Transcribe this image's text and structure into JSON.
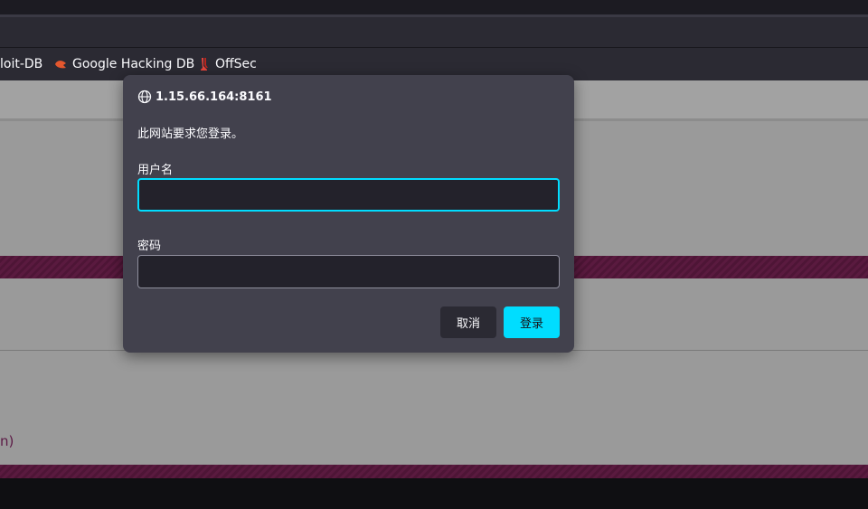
{
  "bookmarks": {
    "items": [
      {
        "label": "loit-DB",
        "icon": "exploit-db-icon"
      },
      {
        "label": "Google Hacking DB",
        "icon": "google-hacking-db-icon"
      },
      {
        "label": "OffSec",
        "icon": "offsec-icon"
      }
    ]
  },
  "page": {
    "link_fragment": "n)"
  },
  "dialog": {
    "origin": "1.15.66.164:8161",
    "message": "此网站要求您登录。",
    "username_label": "用户名",
    "username_value": "",
    "password_label": "密码",
    "password_value": "",
    "cancel_label": "取消",
    "login_label": "登录"
  },
  "colors": {
    "dialog_bg": "#42414d",
    "accent": "#00ddff",
    "stripe": "#5a1a3f",
    "page_bg": "#9a9a9a"
  }
}
